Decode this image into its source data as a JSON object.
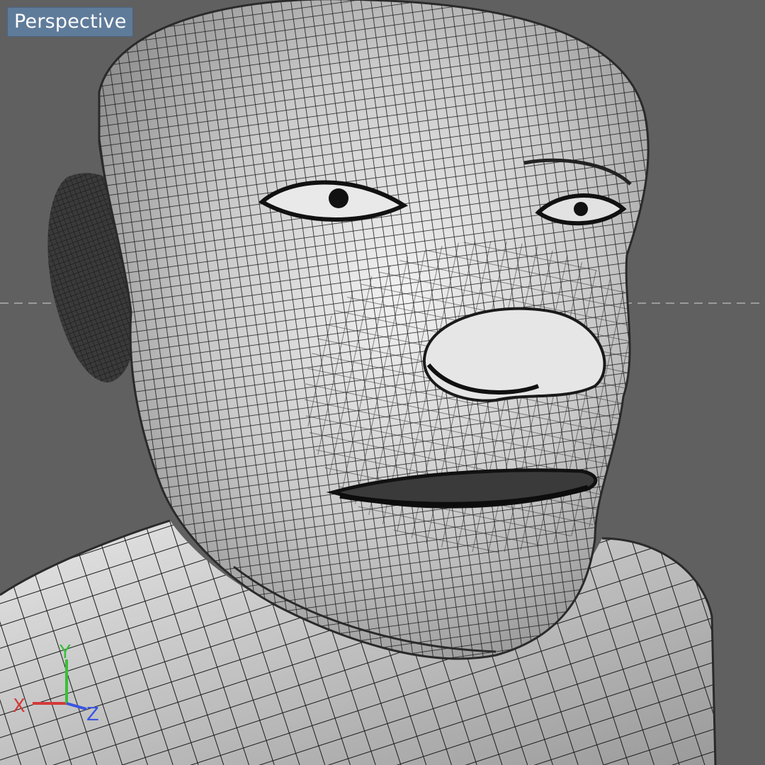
{
  "viewport": {
    "view_label": "Perspective",
    "background_color": "#606060",
    "mesh_fill_color": "#cfcfcf",
    "wire_color": "#1a1a1a",
    "horizon_line": "dashed-gray"
  },
  "axis_gizmo": {
    "x_label": "X",
    "y_label": "Y",
    "z_label": "Z",
    "x_color": "#d33a3a",
    "y_color": "#39c03a",
    "z_color": "#3a55e0"
  }
}
